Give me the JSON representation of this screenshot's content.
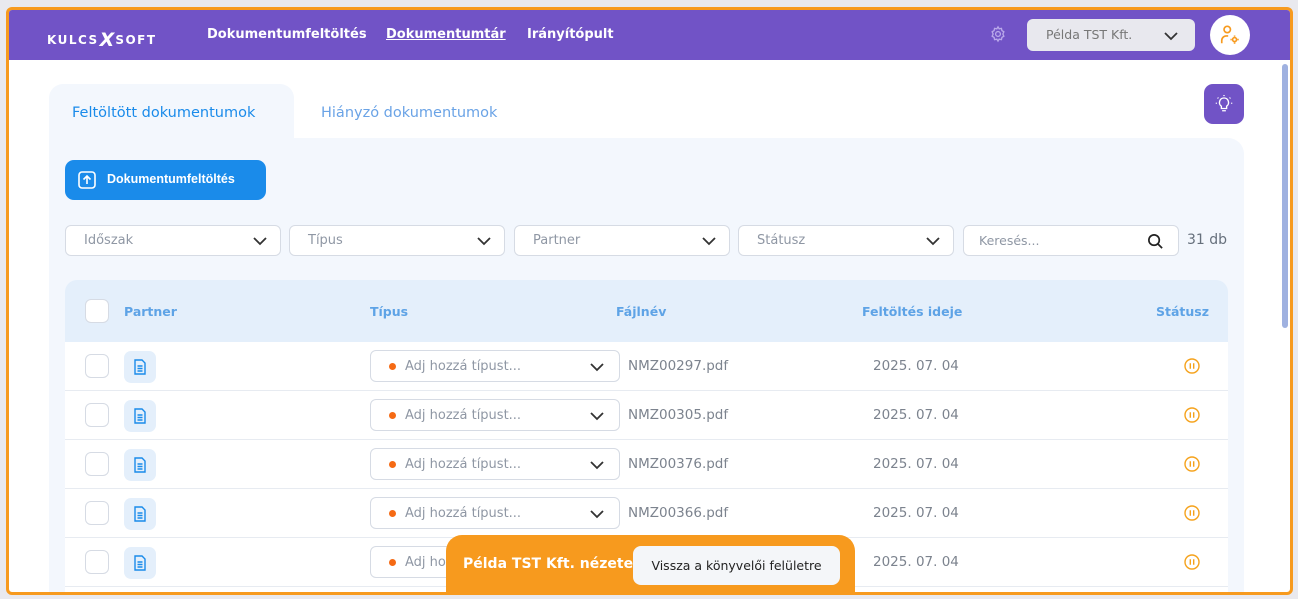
{
  "header": {
    "logo": {
      "left": "KULCS",
      "x": "X",
      "right": "SOFT"
    },
    "nav": [
      "Dokumentumfeltöltés",
      "Dokumentumtár",
      "Irányítópult"
    ],
    "active_nav": "Dokumentumtár",
    "company": "Példa TST Kft.",
    "icons": [
      "gear-icon",
      "chevron-down-icon",
      "user-settings-icon"
    ],
    "brand_color": "#7153c6"
  },
  "tabs": [
    "Feltöltött dokumentumok",
    "Hiányzó dokumentumok"
  ],
  "upload_button": "Dokumentumfeltöltés",
  "filters": [
    "Időszak",
    "Típus",
    "Partner",
    "Státusz"
  ],
  "search": {
    "placeholder": "Keresés..."
  },
  "count": "31 db",
  "table": {
    "headers": [
      "Partner",
      "Típus",
      "Fájlnév",
      "Feltöltés ideje",
      "Státusz"
    ],
    "type_placeholder": "Adj hozzá típust...",
    "rows": [
      {
        "file": "NMZ00297.pdf",
        "date": "2025. 07. 04",
        "status": "pending"
      },
      {
        "file": "NMZ00305.pdf",
        "date": "2025. 07. 04",
        "status": "pending"
      },
      {
        "file": "NMZ00376.pdf",
        "date": "2025. 07. 04",
        "status": "pending"
      },
      {
        "file": "NMZ00366.pdf",
        "date": "2025. 07. 04",
        "status": "pending"
      },
      {
        "file": "",
        "date": "2025. 07. 04",
        "status": "pending"
      }
    ]
  },
  "banner": {
    "text": "Példa TST Kft. nézete",
    "button": "Vissza a könyvelői felületre",
    "color": "#f79a1e"
  }
}
